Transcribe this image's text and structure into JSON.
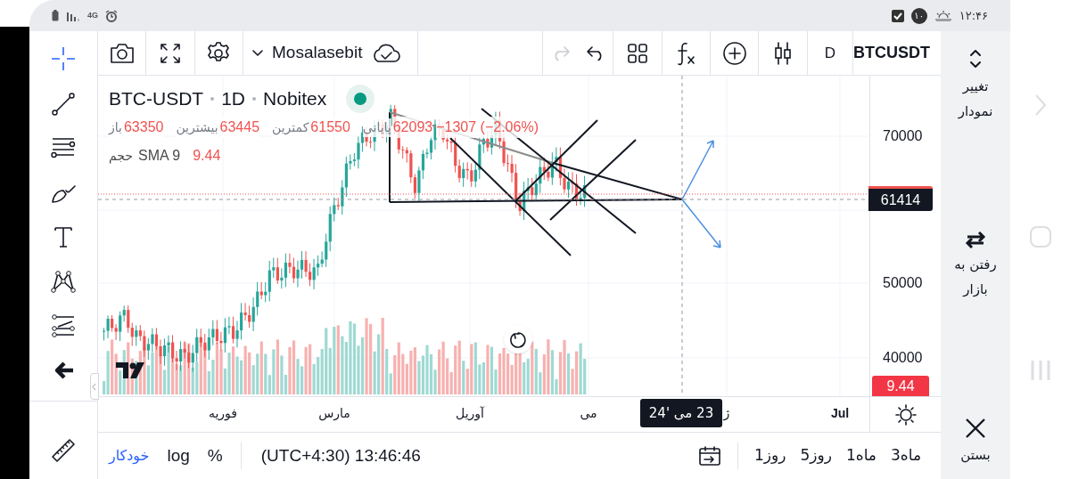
{
  "status_bar": {
    "network": "4G",
    "badge": "۱۰",
    "time": "۱۲:۴۶"
  },
  "toolbar": {
    "layout_name": "Mosalasebit",
    "interval": "D",
    "symbol": "BTCUSDT",
    "redo_disabled": true
  },
  "drawing_tools": [
    {
      "kind": "crosshair",
      "selected": true
    },
    {
      "kind": "trendline",
      "selected": false
    },
    {
      "kind": "fib",
      "selected": false
    },
    {
      "kind": "brush",
      "selected": false
    },
    {
      "kind": "text",
      "selected": false
    },
    {
      "kind": "pattern",
      "selected": false
    },
    {
      "kind": "forecast",
      "selected": false
    },
    {
      "kind": "back",
      "selected": false
    },
    {
      "kind": "ruler",
      "selected": false
    }
  ],
  "legend": {
    "symbol": "BTC-USDT",
    "interval": "1D",
    "exchange": "Nobitex",
    "ohlc": [
      {
        "kind": "value",
        "text": "62093"
      },
      {
        "kind": "label",
        "text": "پایانی"
      },
      {
        "kind": "value",
        "text": "61550"
      },
      {
        "kind": "label",
        "text": "کمترین"
      },
      {
        "kind": "value",
        "text": "63445"
      },
      {
        "kind": "label",
        "text": "بیشترین"
      },
      {
        "kind": "value",
        "text": "63350"
      },
      {
        "kind": "label",
        "text": "باز"
      }
    ],
    "change": "−1307 (−2.06%)",
    "volume": {
      "label": "حجم",
      "study": "SMA 9",
      "value": "9.44"
    }
  },
  "price_axis": {
    "ticks": [
      "70000",
      "50000",
      "40000"
    ],
    "last_price": "61414",
    "volume_value": "9.44"
  },
  "time_axis": {
    "labels": [
      "Jul",
      "ژ",
      "می",
      "آوریل",
      "مارس",
      "فوریه"
    ],
    "crosshair_label": "23 می '24"
  },
  "bottom_bar": {
    "ranges": [
      "3ماه",
      "1ماه",
      "5روز",
      "1روز"
    ],
    "clock": "(UTC+4:30) 13:46:46",
    "percent": "%",
    "log": "log",
    "auto": "خودکار"
  },
  "side_panel": [
    {
      "kind": "chart-type",
      "label": "تغییر نمودار"
    },
    {
      "kind": "market",
      "label": "رفتن به بازار"
    },
    {
      "kind": "close",
      "label": "بستن"
    }
  ]
}
